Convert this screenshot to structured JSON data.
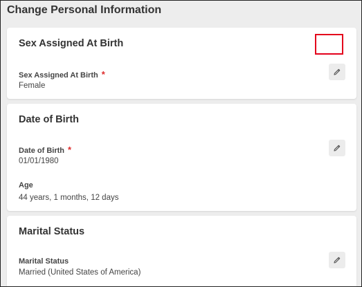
{
  "page": {
    "title": "Change Personal Information"
  },
  "sections": [
    {
      "title": "Sex Assigned At Birth",
      "fields": [
        {
          "label": "Sex Assigned At Birth",
          "required": true,
          "value": "Female"
        }
      ],
      "edit_icon": "pencil-icon"
    },
    {
      "title": "Date of Birth",
      "fields": [
        {
          "label": "Date of Birth",
          "required": true,
          "value": "01/01/1980"
        },
        {
          "label": "Age",
          "required": false,
          "value": "44 years, 1 months, 12 days"
        }
      ],
      "edit_icon": "pencil-icon"
    },
    {
      "title": "Marital Status",
      "fields": [
        {
          "label": "Marital Status",
          "required": false,
          "value": "Married (United States of America)"
        }
      ],
      "edit_icon": "pencil-icon"
    }
  ],
  "required_marker": "*",
  "colors": {
    "background": "#ededed",
    "card": "#ffffff",
    "required": "#de2c2c",
    "highlight": "#e3001b",
    "edit_button": "#ececec"
  }
}
